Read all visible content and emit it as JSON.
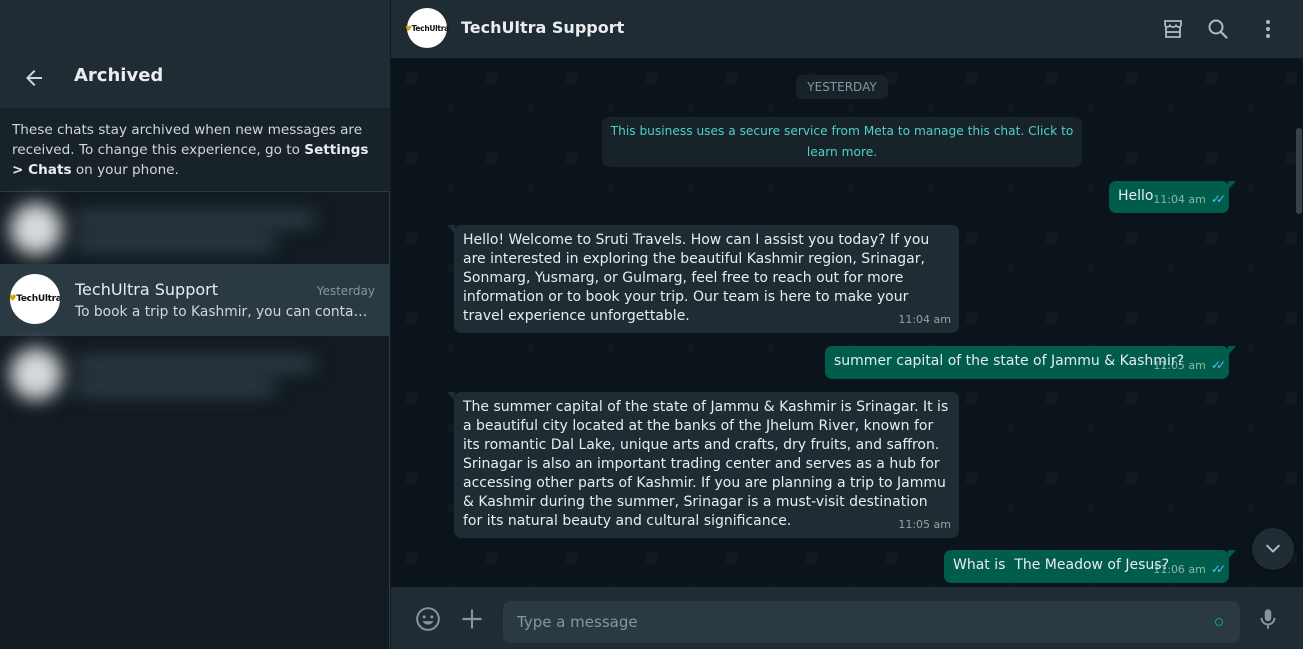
{
  "sidebar": {
    "title": "Archived",
    "note_prefix": "These chats stay archived when new messages are received. To change this experience, go to ",
    "note_bold": "Settings > Chats",
    "note_suffix": " on your phone.",
    "active_chat": {
      "name": "TechUltra Support",
      "time": "Yesterday",
      "preview": "To book a trip to Kashmir, you can contact Sruti Travels",
      "avatar_logo_mark": "♥",
      "avatar_logo_text": "TechUltra"
    }
  },
  "header": {
    "title": "TechUltra Support",
    "avatar_logo_mark": "♥",
    "avatar_logo_text": "TechUltra",
    "icons": [
      "shop-icon",
      "search-icon",
      "menu-icon"
    ]
  },
  "conversation": {
    "date_chip": "YESTERDAY",
    "system_message": "This business uses a secure service from Meta to manage this chat. Click to learn more.",
    "messages": [
      {
        "direction": "out",
        "text": "Hello",
        "time": "11:04 am"
      },
      {
        "direction": "in",
        "text": "Hello! Welcome to Sruti Travels. How can I assist you today? If you are interested in exploring the beautiful Kashmir region, Srinagar, Sonmarg, Yusmarg, or Gulmarg, feel free to reach out for more information or to book your trip. Our team is here to make your travel experience unforgettable.",
        "time": "11:04 am"
      },
      {
        "direction": "out",
        "text": "summer capital of the state of Jammu & Kashmir?",
        "time": "11:05 am"
      },
      {
        "direction": "in",
        "text": "The summer capital of the state of Jammu & Kashmir is Srinagar. It is a beautiful city located at the banks of the Jhelum River, known for its romantic Dal Lake, unique arts and crafts, dry fruits, and saffron. Srinagar is also an important trading center and serves as a hub for accessing other parts of Kashmir. If you are planning a trip to Jammu & Kashmir during the summer, Srinagar is a must-visit destination for its natural beauty and cultural significance.",
        "time": "11:05 am"
      },
      {
        "direction": "out",
        "text": "What is  The Meadow of Jesus?",
        "time": "11:06 am"
      }
    ]
  },
  "composer": {
    "placeholder": "Type a message"
  },
  "colors": {
    "outgoing_bubble": "#005c4b",
    "incoming_bubble": "#202c33",
    "read_ticks": "#53bdeb",
    "accent": "#00a884"
  }
}
